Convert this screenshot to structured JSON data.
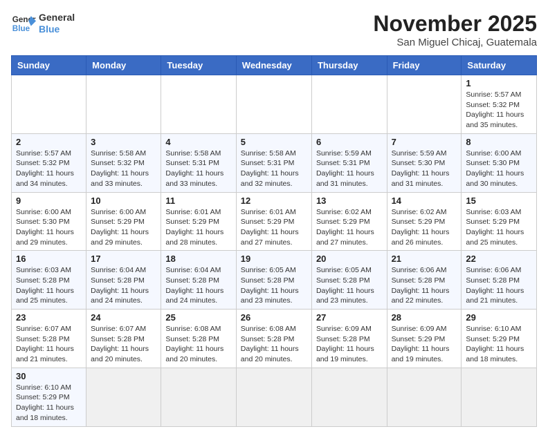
{
  "header": {
    "logo_general": "General",
    "logo_blue": "Blue",
    "month_title": "November 2025",
    "subtitle": "San Miguel Chicaj, Guatemala"
  },
  "days_of_week": [
    "Sunday",
    "Monday",
    "Tuesday",
    "Wednesday",
    "Thursday",
    "Friday",
    "Saturday"
  ],
  "weeks": [
    [
      {
        "day": "",
        "info": ""
      },
      {
        "day": "",
        "info": ""
      },
      {
        "day": "",
        "info": ""
      },
      {
        "day": "",
        "info": ""
      },
      {
        "day": "",
        "info": ""
      },
      {
        "day": "",
        "info": ""
      },
      {
        "day": "1",
        "info": "Sunrise: 5:57 AM\nSunset: 5:32 PM\nDaylight: 11 hours\nand 35 minutes."
      }
    ],
    [
      {
        "day": "2",
        "info": "Sunrise: 5:57 AM\nSunset: 5:32 PM\nDaylight: 11 hours\nand 34 minutes."
      },
      {
        "day": "3",
        "info": "Sunrise: 5:58 AM\nSunset: 5:32 PM\nDaylight: 11 hours\nand 33 minutes."
      },
      {
        "day": "4",
        "info": "Sunrise: 5:58 AM\nSunset: 5:31 PM\nDaylight: 11 hours\nand 33 minutes."
      },
      {
        "day": "5",
        "info": "Sunrise: 5:58 AM\nSunset: 5:31 PM\nDaylight: 11 hours\nand 32 minutes."
      },
      {
        "day": "6",
        "info": "Sunrise: 5:59 AM\nSunset: 5:31 PM\nDaylight: 11 hours\nand 31 minutes."
      },
      {
        "day": "7",
        "info": "Sunrise: 5:59 AM\nSunset: 5:30 PM\nDaylight: 11 hours\nand 31 minutes."
      },
      {
        "day": "8",
        "info": "Sunrise: 6:00 AM\nSunset: 5:30 PM\nDaylight: 11 hours\nand 30 minutes."
      }
    ],
    [
      {
        "day": "9",
        "info": "Sunrise: 6:00 AM\nSunset: 5:30 PM\nDaylight: 11 hours\nand 29 minutes."
      },
      {
        "day": "10",
        "info": "Sunrise: 6:00 AM\nSunset: 5:29 PM\nDaylight: 11 hours\nand 29 minutes."
      },
      {
        "day": "11",
        "info": "Sunrise: 6:01 AM\nSunset: 5:29 PM\nDaylight: 11 hours\nand 28 minutes."
      },
      {
        "day": "12",
        "info": "Sunrise: 6:01 AM\nSunset: 5:29 PM\nDaylight: 11 hours\nand 27 minutes."
      },
      {
        "day": "13",
        "info": "Sunrise: 6:02 AM\nSunset: 5:29 PM\nDaylight: 11 hours\nand 27 minutes."
      },
      {
        "day": "14",
        "info": "Sunrise: 6:02 AM\nSunset: 5:29 PM\nDaylight: 11 hours\nand 26 minutes."
      },
      {
        "day": "15",
        "info": "Sunrise: 6:03 AM\nSunset: 5:29 PM\nDaylight: 11 hours\nand 25 minutes."
      }
    ],
    [
      {
        "day": "16",
        "info": "Sunrise: 6:03 AM\nSunset: 5:28 PM\nDaylight: 11 hours\nand 25 minutes."
      },
      {
        "day": "17",
        "info": "Sunrise: 6:04 AM\nSunset: 5:28 PM\nDaylight: 11 hours\nand 24 minutes."
      },
      {
        "day": "18",
        "info": "Sunrise: 6:04 AM\nSunset: 5:28 PM\nDaylight: 11 hours\nand 24 minutes."
      },
      {
        "day": "19",
        "info": "Sunrise: 6:05 AM\nSunset: 5:28 PM\nDaylight: 11 hours\nand 23 minutes."
      },
      {
        "day": "20",
        "info": "Sunrise: 6:05 AM\nSunset: 5:28 PM\nDaylight: 11 hours\nand 23 minutes."
      },
      {
        "day": "21",
        "info": "Sunrise: 6:06 AM\nSunset: 5:28 PM\nDaylight: 11 hours\nand 22 minutes."
      },
      {
        "day": "22",
        "info": "Sunrise: 6:06 AM\nSunset: 5:28 PM\nDaylight: 11 hours\nand 21 minutes."
      }
    ],
    [
      {
        "day": "23",
        "info": "Sunrise: 6:07 AM\nSunset: 5:28 PM\nDaylight: 11 hours\nand 21 minutes."
      },
      {
        "day": "24",
        "info": "Sunrise: 6:07 AM\nSunset: 5:28 PM\nDaylight: 11 hours\nand 20 minutes."
      },
      {
        "day": "25",
        "info": "Sunrise: 6:08 AM\nSunset: 5:28 PM\nDaylight: 11 hours\nand 20 minutes."
      },
      {
        "day": "26",
        "info": "Sunrise: 6:08 AM\nSunset: 5:28 PM\nDaylight: 11 hours\nand 20 minutes."
      },
      {
        "day": "27",
        "info": "Sunrise: 6:09 AM\nSunset: 5:28 PM\nDaylight: 11 hours\nand 19 minutes."
      },
      {
        "day": "28",
        "info": "Sunrise: 6:09 AM\nSunset: 5:29 PM\nDaylight: 11 hours\nand 19 minutes."
      },
      {
        "day": "29",
        "info": "Sunrise: 6:10 AM\nSunset: 5:29 PM\nDaylight: 11 hours\nand 18 minutes."
      }
    ],
    [
      {
        "day": "30",
        "info": "Sunrise: 6:10 AM\nSunset: 5:29 PM\nDaylight: 11 hours\nand 18 minutes."
      },
      {
        "day": "",
        "info": ""
      },
      {
        "day": "",
        "info": ""
      },
      {
        "day": "",
        "info": ""
      },
      {
        "day": "",
        "info": ""
      },
      {
        "day": "",
        "info": ""
      },
      {
        "day": "",
        "info": ""
      }
    ]
  ]
}
